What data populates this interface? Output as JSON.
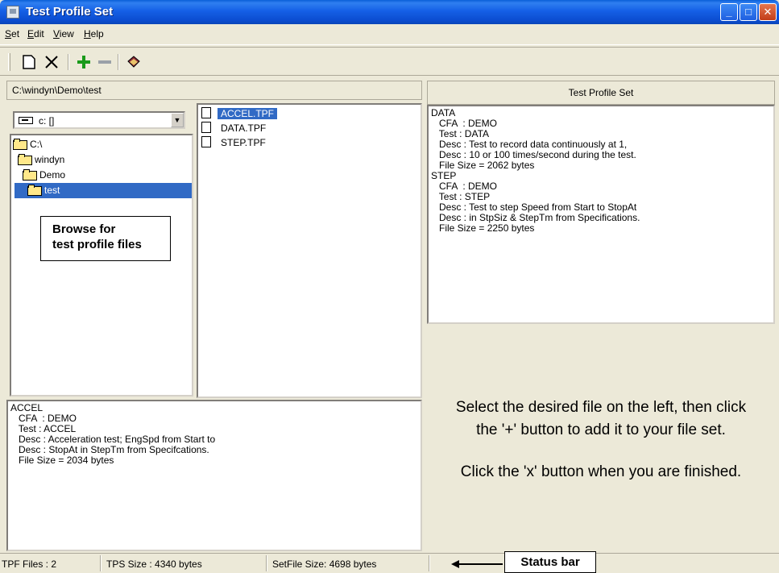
{
  "window": {
    "title": "Test Profile Set"
  },
  "menu": {
    "items": [
      {
        "ul": "S",
        "rest": "et"
      },
      {
        "ul": "E",
        "rest": "dit"
      },
      {
        "ul": "V",
        "rest": "iew"
      },
      {
        "ul": "H",
        "rest": "elp"
      }
    ]
  },
  "toolbar": {
    "icons": [
      "new-file-icon",
      "delete-icon",
      "add-icon",
      "remove-icon",
      "book-icon"
    ]
  },
  "path": "C:\\windyn\\Demo\\test",
  "drive": {
    "value": "c: []"
  },
  "tree": [
    {
      "label": "C:\\",
      "selected": false
    },
    {
      "label": "windyn",
      "selected": false
    },
    {
      "label": "Demo",
      "selected": false
    },
    {
      "label": "test",
      "selected": true
    }
  ],
  "callout_browse": {
    "line1": "Browse for",
    "line2": "test profile files"
  },
  "files": [
    {
      "name": "ACCEL.TPF",
      "selected": true
    },
    {
      "name": "DATA.TPF",
      "selected": false
    },
    {
      "name": "STEP.TPF",
      "selected": false
    }
  ],
  "file_info": [
    "ACCEL",
    "   CFA  : DEMO",
    "   Test : ACCEL",
    "   Desc : Acceleration test; EngSpd from Start to",
    "   Desc : StopAt in StepTm from Specifcations.",
    "   File Size = 2034 bytes"
  ],
  "set_panel": {
    "header": "Test Profile Set"
  },
  "set_info": [
    "DATA",
    "   CFA  : DEMO",
    "   Test : DATA",
    "   Desc : Test to record data continuously at 1,",
    "   Desc : 10 or 100 times/second during the test.",
    "   File Size = 2062 bytes",
    "STEP",
    "   CFA  : DEMO",
    "   Test : STEP",
    "   Desc : Test to step Speed from Start to StopAt",
    "   Desc : in StpSiz & StepTm from Specifications.",
    "   File Size = 2250 bytes"
  ],
  "instructions": {
    "line1": "Select the desired file on the left, then click",
    "line2": "the '+' button to add it to your file set.",
    "line3": "Click the 'x' button when you are finished."
  },
  "status": {
    "tpf_files": "TPF Files : 2",
    "tps_size": "TPS Size : 4340 bytes",
    "setfile_size": "SetFile Size: 4698 bytes",
    "callout": "Status bar"
  }
}
